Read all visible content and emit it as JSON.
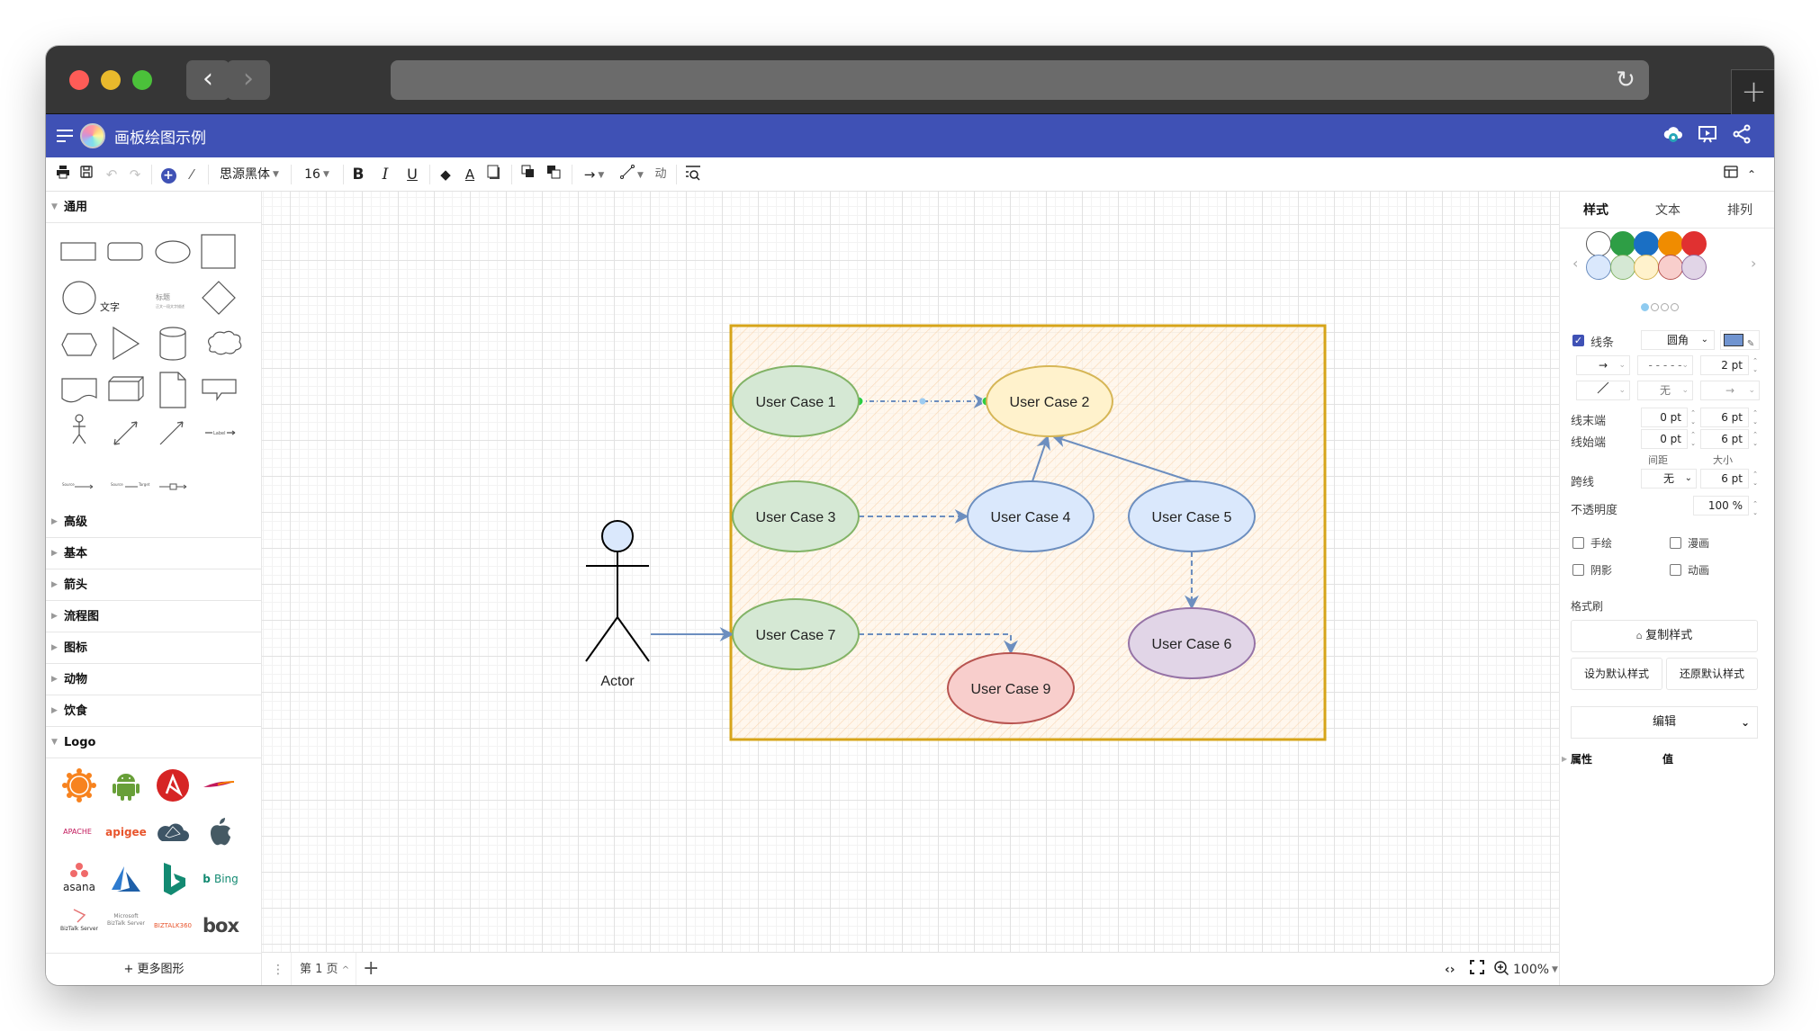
{
  "browser": {
    "back_icon": "‹",
    "forward_icon": "›",
    "reload_icon": "↻",
    "new_tab_icon": "+"
  },
  "app": {
    "title": "画板绘图示例",
    "header_icons": [
      "cloud-sync-icon",
      "presentation-icon",
      "share-icon"
    ]
  },
  "toolbar": {
    "font_family": "思源黑体",
    "font_size": "16",
    "bold": "B",
    "italic": "I",
    "underline": "U",
    "text_color": "A",
    "insert_icon": "+"
  },
  "sidebar": {
    "sections": [
      {
        "label": "通用",
        "expanded": true
      },
      {
        "label": "高级",
        "expanded": false
      },
      {
        "label": "基本",
        "expanded": false
      },
      {
        "label": "箭头",
        "expanded": false
      },
      {
        "label": "流程图",
        "expanded": false
      },
      {
        "label": "图标",
        "expanded": false
      },
      {
        "label": "动物",
        "expanded": false
      },
      {
        "label": "饮食",
        "expanded": false
      },
      {
        "label": "Logo",
        "expanded": true
      }
    ],
    "general_shapes": {
      "text_label": "文字",
      "heading_label": "标题",
      "heading_sub": "正文一段文字描述",
      "edge_label": "Label",
      "source_label": "Source",
      "target_label": "Target"
    },
    "logos": [
      "Grafana",
      "Android",
      "Ansible",
      "Apache feather",
      "Apache",
      "apigee",
      "Cloud",
      "Apple",
      "asana",
      "Azure",
      "Bing logo",
      "Bing",
      "BizTalk Server",
      "Microsoft BizTalk Server",
      "BizTalk360",
      "box"
    ],
    "logo_text": {
      "apache": "APACHE",
      "apigee": "apigee",
      "asana": "asana",
      "bing": "Bing",
      "biztalk": "BizTalk Server",
      "ms_biztalk_1": "Microsoft",
      "ms_biztalk_2": "BizTalk Server",
      "biztalk360": "BIZTALK360",
      "box": "box"
    },
    "more_shapes": "+ 更多图形"
  },
  "diagram": {
    "boundary": {
      "stroke": "#d6a419",
      "fill": "#fff4e6"
    },
    "actor": {
      "label": "Actor"
    },
    "nodes": [
      {
        "id": "uc1",
        "label": "User Case 1",
        "fill": "#d5e8d4",
        "stroke": "#82b366"
      },
      {
        "id": "uc2",
        "label": "User Case 2",
        "fill": "#fff2cc",
        "stroke": "#d6b656"
      },
      {
        "id": "uc3",
        "label": "User Case 3",
        "fill": "#d5e8d4",
        "stroke": "#82b366"
      },
      {
        "id": "uc4",
        "label": "User Case 4",
        "fill": "#dae8fc",
        "stroke": "#6c8ebf"
      },
      {
        "id": "uc5",
        "label": "User Case 5",
        "fill": "#dae8fc",
        "stroke": "#6c8ebf"
      },
      {
        "id": "uc6",
        "label": "User Case 6",
        "fill": "#e1d5e7",
        "stroke": "#9673a6"
      },
      {
        "id": "uc7",
        "label": "User Case 7",
        "fill": "#d5e8d4",
        "stroke": "#82b366"
      },
      {
        "id": "uc9",
        "label": "User Case 9",
        "fill": "#f8cecc",
        "stroke": "#b85450"
      }
    ],
    "edges": [
      {
        "from": "uc1",
        "to": "uc2",
        "style": "dashed",
        "selected": true
      },
      {
        "from": "uc3",
        "to": "uc4",
        "style": "dashed"
      },
      {
        "from": "uc4",
        "to": "uc2",
        "style": "solid"
      },
      {
        "from": "uc5",
        "to": "uc2",
        "style": "solid"
      },
      {
        "from": "uc5",
        "to": "uc6",
        "style": "dashed"
      },
      {
        "from": "actor",
        "to": "uc7",
        "style": "solid"
      },
      {
        "from": "uc7",
        "to": "uc9",
        "style": "dashed"
      }
    ]
  },
  "statusbar": {
    "page_label": "第 1 页",
    "page_caret": "^",
    "add_page": "+",
    "zoom_level": "100%"
  },
  "panel": {
    "tabs": [
      "样式",
      "文本",
      "排列"
    ],
    "swatches_row1": [
      "#ffffff",
      "#2e9e45",
      "#1a6fc4",
      "#f08c00",
      "#e03131"
    ],
    "swatches_row1_stroke": [
      "#555555",
      "#2e9e45",
      "#1a6fc4",
      "#f08c00",
      "#e03131"
    ],
    "swatches_row2": [
      "#dae8fc",
      "#d5e8d4",
      "#fff2cc",
      "#f8cecc",
      "#e1d5e7"
    ],
    "swatches_row2_stroke": [
      "#6c8ebf",
      "#82b366",
      "#d6b656",
      "#b85450",
      "#9673a6"
    ],
    "swatch_page": 1,
    "swatch_pages": 4,
    "line": {
      "enabled": true,
      "label": "线条",
      "corner": "圆角",
      "color": "#7094d0",
      "width": "2 pt",
      "waypoint": "无",
      "end_label": "线末端",
      "start_label": "线始端",
      "end_spacing": "0 pt",
      "end_size": "6 pt",
      "start_spacing": "0 pt",
      "start_size": "6 pt",
      "spacing_caption": "间距",
      "size_caption": "大小",
      "jump_label": "跨线",
      "jump_value": "无",
      "jump_size": "6 pt",
      "opacity_label": "不透明度",
      "opacity_value": "100 %"
    },
    "checkboxes": [
      {
        "label": "手绘",
        "checked": false
      },
      {
        "label": "漫画",
        "checked": false
      },
      {
        "label": "阴影",
        "checked": false
      },
      {
        "label": "动画",
        "checked": false
      }
    ],
    "format_painter_label": "格式刷",
    "copy_style": "复制样式",
    "set_default": "设为默认样式",
    "restore_default": "还原默认样式",
    "edit_select": "编辑",
    "props_header": "属性",
    "value_header": "值"
  }
}
